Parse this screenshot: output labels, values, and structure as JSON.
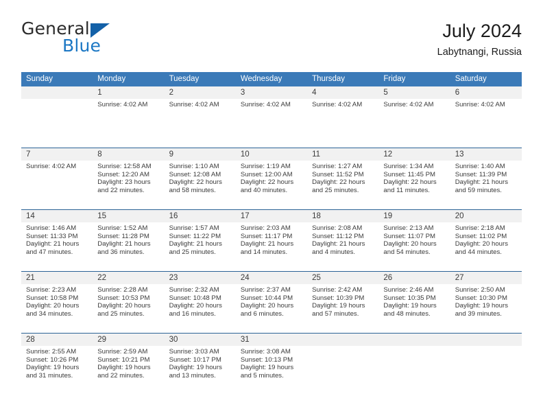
{
  "brand": {
    "name_top": "General",
    "name_bottom": "Blue",
    "triangle_color": "#1361a8",
    "blue_color": "#1b77c4"
  },
  "header": {
    "title": "July 2024",
    "subtitle": "Labytnangi, Russia"
  },
  "theme": {
    "header_bg": "#3b7ab8",
    "header_text": "#ffffff",
    "row_separator": "#2a6296",
    "day_band_bg": "#f1f1f1",
    "text": "#3a3a3a"
  },
  "weekdays": [
    "Sunday",
    "Monday",
    "Tuesday",
    "Wednesday",
    "Thursday",
    "Friday",
    "Saturday"
  ],
  "weeks": [
    [
      {
        "day": "",
        "lines": []
      },
      {
        "day": "1",
        "lines": [
          "Sunrise: 4:02 AM"
        ]
      },
      {
        "day": "2",
        "lines": [
          "Sunrise: 4:02 AM"
        ]
      },
      {
        "day": "3",
        "lines": [
          "Sunrise: 4:02 AM"
        ]
      },
      {
        "day": "4",
        "lines": [
          "Sunrise: 4:02 AM"
        ]
      },
      {
        "day": "5",
        "lines": [
          "Sunrise: 4:02 AM"
        ]
      },
      {
        "day": "6",
        "lines": [
          "Sunrise: 4:02 AM"
        ]
      }
    ],
    [
      {
        "day": "7",
        "lines": [
          "Sunrise: 4:02 AM"
        ]
      },
      {
        "day": "8",
        "lines": [
          "Sunrise: 12:58 AM",
          "Sunset: 12:20 AM",
          "Daylight: 23 hours and 22 minutes."
        ]
      },
      {
        "day": "9",
        "lines": [
          "Sunrise: 1:10 AM",
          "Sunset: 12:08 AM",
          "Daylight: 22 hours and 58 minutes."
        ]
      },
      {
        "day": "10",
        "lines": [
          "Sunrise: 1:19 AM",
          "Sunset: 12:00 AM",
          "Daylight: 22 hours and 40 minutes."
        ]
      },
      {
        "day": "11",
        "lines": [
          "Sunrise: 1:27 AM",
          "Sunset: 11:52 PM",
          "Daylight: 22 hours and 25 minutes."
        ]
      },
      {
        "day": "12",
        "lines": [
          "Sunrise: 1:34 AM",
          "Sunset: 11:45 PM",
          "Daylight: 22 hours and 11 minutes."
        ]
      },
      {
        "day": "13",
        "lines": [
          "Sunrise: 1:40 AM",
          "Sunset: 11:39 PM",
          "Daylight: 21 hours and 59 minutes."
        ]
      }
    ],
    [
      {
        "day": "14",
        "lines": [
          "Sunrise: 1:46 AM",
          "Sunset: 11:33 PM",
          "Daylight: 21 hours and 47 minutes."
        ]
      },
      {
        "day": "15",
        "lines": [
          "Sunrise: 1:52 AM",
          "Sunset: 11:28 PM",
          "Daylight: 21 hours and 36 minutes."
        ]
      },
      {
        "day": "16",
        "lines": [
          "Sunrise: 1:57 AM",
          "Sunset: 11:22 PM",
          "Daylight: 21 hours and 25 minutes."
        ]
      },
      {
        "day": "17",
        "lines": [
          "Sunrise: 2:03 AM",
          "Sunset: 11:17 PM",
          "Daylight: 21 hours and 14 minutes."
        ]
      },
      {
        "day": "18",
        "lines": [
          "Sunrise: 2:08 AM",
          "Sunset: 11:12 PM",
          "Daylight: 21 hours and 4 minutes."
        ]
      },
      {
        "day": "19",
        "lines": [
          "Sunrise: 2:13 AM",
          "Sunset: 11:07 PM",
          "Daylight: 20 hours and 54 minutes."
        ]
      },
      {
        "day": "20",
        "lines": [
          "Sunrise: 2:18 AM",
          "Sunset: 11:02 PM",
          "Daylight: 20 hours and 44 minutes."
        ]
      }
    ],
    [
      {
        "day": "21",
        "lines": [
          "Sunrise: 2:23 AM",
          "Sunset: 10:58 PM",
          "Daylight: 20 hours and 34 minutes."
        ]
      },
      {
        "day": "22",
        "lines": [
          "Sunrise: 2:28 AM",
          "Sunset: 10:53 PM",
          "Daylight: 20 hours and 25 minutes."
        ]
      },
      {
        "day": "23",
        "lines": [
          "Sunrise: 2:32 AM",
          "Sunset: 10:48 PM",
          "Daylight: 20 hours and 16 minutes."
        ]
      },
      {
        "day": "24",
        "lines": [
          "Sunrise: 2:37 AM",
          "Sunset: 10:44 PM",
          "Daylight: 20 hours and 6 minutes."
        ]
      },
      {
        "day": "25",
        "lines": [
          "Sunrise: 2:42 AM",
          "Sunset: 10:39 PM",
          "Daylight: 19 hours and 57 minutes."
        ]
      },
      {
        "day": "26",
        "lines": [
          "Sunrise: 2:46 AM",
          "Sunset: 10:35 PM",
          "Daylight: 19 hours and 48 minutes."
        ]
      },
      {
        "day": "27",
        "lines": [
          "Sunrise: 2:50 AM",
          "Sunset: 10:30 PM",
          "Daylight: 19 hours and 39 minutes."
        ]
      }
    ],
    [
      {
        "day": "28",
        "lines": [
          "Sunrise: 2:55 AM",
          "Sunset: 10:26 PM",
          "Daylight: 19 hours and 31 minutes."
        ]
      },
      {
        "day": "29",
        "lines": [
          "Sunrise: 2:59 AM",
          "Sunset: 10:21 PM",
          "Daylight: 19 hours and 22 minutes."
        ]
      },
      {
        "day": "30",
        "lines": [
          "Sunrise: 3:03 AM",
          "Sunset: 10:17 PM",
          "Daylight: 19 hours and 13 minutes."
        ]
      },
      {
        "day": "31",
        "lines": [
          "Sunrise: 3:08 AM",
          "Sunset: 10:13 PM",
          "Daylight: 19 hours and 5 minutes."
        ]
      },
      {
        "day": "",
        "lines": []
      },
      {
        "day": "",
        "lines": []
      },
      {
        "day": "",
        "lines": []
      }
    ]
  ]
}
